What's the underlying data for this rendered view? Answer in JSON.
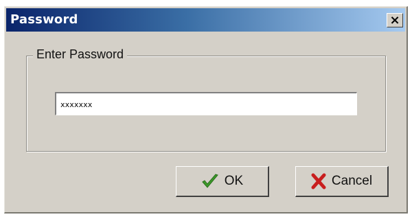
{
  "window": {
    "title": "Password",
    "close_glyph": "×"
  },
  "group": {
    "label": "Enter Password"
  },
  "password_field": {
    "value": "xxxxxxx"
  },
  "buttons": {
    "ok_label": "OK",
    "ok_icon": "checkmark-icon",
    "cancel_label": "Cancel",
    "cancel_icon": "x-mark-icon"
  },
  "colors": {
    "title_bar_start": "#0a246a",
    "title_bar_end": "#a6caf0",
    "dialog_face": "#d4d0c8",
    "ok_icon": "#3c9a2a",
    "cancel_icon": "#c81e1e"
  }
}
